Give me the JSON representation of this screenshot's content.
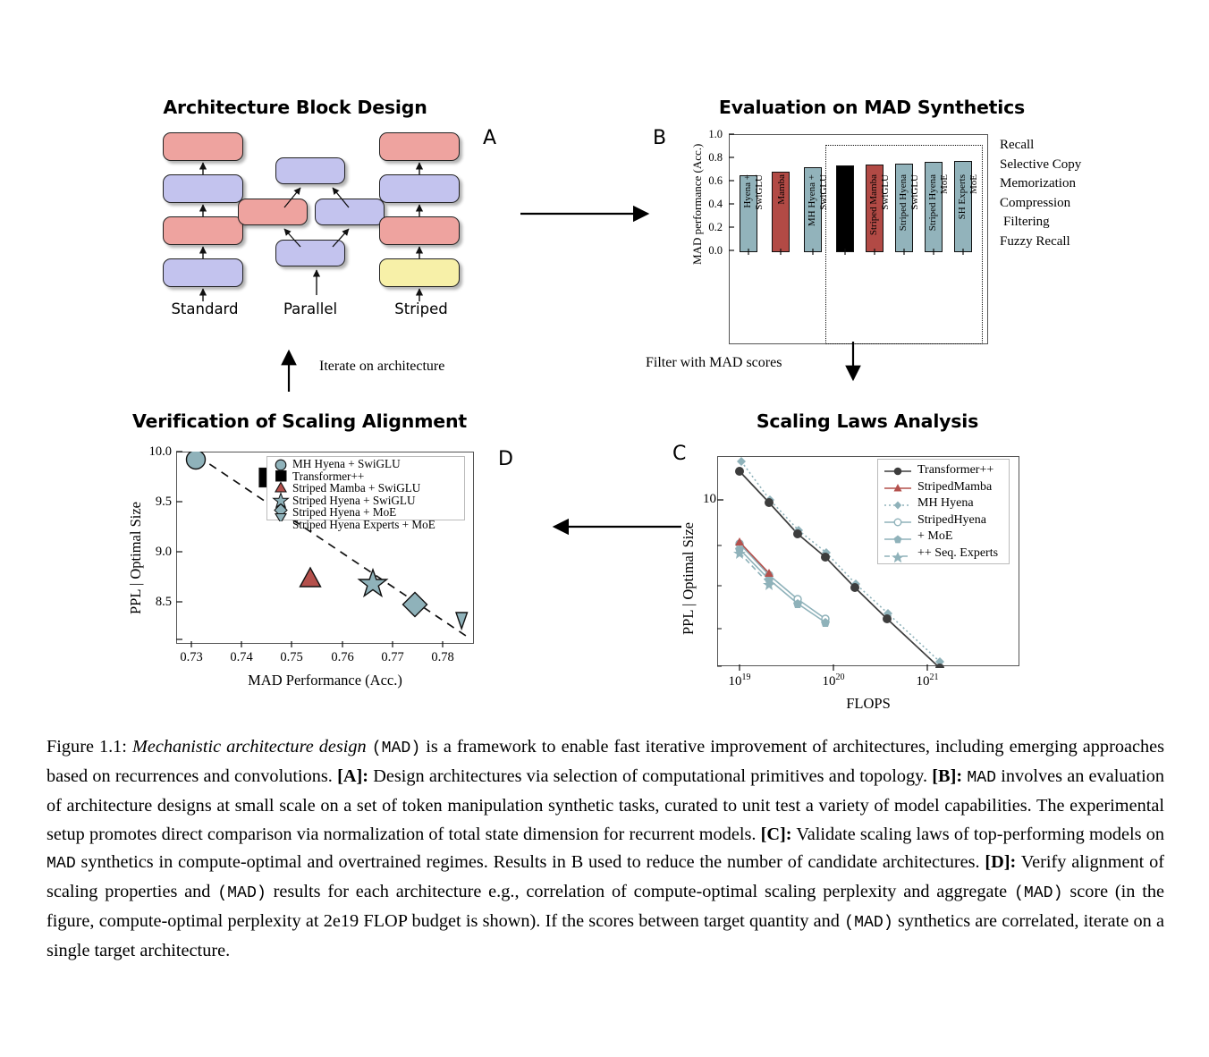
{
  "figure": {
    "label": "Figure 1.1:",
    "caption_segments": [
      {
        "t": "Figure 1.1:",
        "s": "normal"
      },
      {
        "t": "Mechanistic architecture design",
        "s": "italic"
      },
      {
        "t": "(MAD)",
        "s": "mono"
      },
      {
        "t": "is a framework to enable fast iterative improvement of architectures, including emerging approaches based on recurrences and convolutions.",
        "s": "normal"
      },
      {
        "t": "[A]:",
        "s": "bold"
      },
      {
        "t": "Design architectures via selection of computational primitives and topology.",
        "s": "normal"
      },
      {
        "t": "[B]:",
        "s": "bold"
      },
      {
        "t": "MAD",
        "s": "mono"
      },
      {
        "t": "involves an evaluation of architecture designs at small scale on a set of token manipulation synthetic tasks, curated to unit test a variety of model capabilities. The experimental setup promotes direct comparison via normalization of total state dimension for recurrent models.",
        "s": "normal"
      },
      {
        "t": "[C]:",
        "s": "bold"
      },
      {
        "t": "Validate scaling laws of top-performing models on",
        "s": "normal"
      },
      {
        "t": "MAD",
        "s": "mono"
      },
      {
        "t": "synthetics in compute-optimal and overtrained regimes. Results in B used to reduce the number of candidate architectures.",
        "s": "normal"
      },
      {
        "t": "[D]:",
        "s": "bold"
      },
      {
        "t": "Verify alignment of scaling properties and",
        "s": "normal"
      },
      {
        "t": "(MAD)",
        "s": "mono"
      },
      {
        "t": "results for each architecture e.g., correlation of compute-optimal scaling perplexity and aggregate",
        "s": "normal"
      },
      {
        "t": "(MAD)",
        "s": "mono"
      },
      {
        "t": "score (in the figure, compute-optimal perplexity at 2e19 FLOP budget is shown). If the scores between target quantity and",
        "s": "normal"
      },
      {
        "t": "(MAD)",
        "s": "mono"
      },
      {
        "t": "synthetics are correlated, iterate on a single target architecture.",
        "s": "normal"
      }
    ]
  },
  "colors": {
    "block_red": "#eea39f",
    "block_blue": "#c3c3ee",
    "block_yellow": "#f7f0a8",
    "bar_teal": "#92b3bb",
    "bar_red": "#b24a45",
    "bar_black": "#000000",
    "marker_teal": "#8fb2ba",
    "marker_red": "#b4504c",
    "line_dark": "#3d3d3d"
  },
  "panelA": {
    "letter": "A",
    "title": "Architecture Block Design",
    "columns": [
      {
        "name": "Standard",
        "label": "Standard",
        "blocks": [
          {
            "color": "red"
          },
          {
            "color": "blue"
          },
          {
            "color": "red"
          },
          {
            "color": "blue"
          }
        ]
      },
      {
        "name": "Parallel",
        "label": "Parallel",
        "blocks": [
          {
            "color": "blue"
          },
          {
            "color": "red"
          },
          {
            "color": "blue"
          },
          {
            "color": "blue"
          }
        ]
      },
      {
        "name": "Striped",
        "label": "Striped",
        "blocks": [
          {
            "color": "red"
          },
          {
            "color": "blue"
          },
          {
            "color": "red"
          },
          {
            "color": "yellow"
          }
        ]
      }
    ]
  },
  "panelB": {
    "letter": "B",
    "title": "Evaluation on MAD Synthetics",
    "tasks": [
      "Recall",
      "Selective Copy",
      "Memorization",
      "Compression",
      "Filtering",
      "Fuzzy Recall"
    ],
    "chart_data": {
      "type": "bar",
      "title": "Evaluation on MAD Synthetics",
      "xlabel": "",
      "ylabel": "MAD performance (Acc.)",
      "ylim": [
        0.0,
        1.0
      ],
      "yticks": [
        "0.0",
        "0.2",
        "0.4",
        "0.6",
        "0.8",
        "1.0"
      ],
      "grid": false,
      "highlight_group_start": 3,
      "categories": [
        "Hyena +\nSwiGLU",
        "Mamba",
        "MH Hyena +\nSwiGLU",
        "Transformer++",
        "Striped Mamba\nSwiGLU",
        "Striped Hyena\nSwiGLU",
        "Striped Hyena\nMoE",
        "SH Experts\nMoE"
      ],
      "category_lines": [
        [
          "Hyena +",
          "SwiGLU"
        ],
        [
          "Mamba"
        ],
        [
          "MH Hyena +",
          "SwiGLU"
        ],
        [
          "Transformer++"
        ],
        [
          "Striped Mamba",
          "SwiGLU"
        ],
        [
          "Striped Hyena",
          "SwiGLU"
        ],
        [
          "Striped Hyena",
          "MoE"
        ],
        [
          "SH Experts",
          "MoE"
        ]
      ],
      "values": [
        0.661,
        0.693,
        0.732,
        0.747,
        0.752,
        0.765,
        0.774,
        0.783
      ],
      "bar_colors": [
        "teal",
        "red",
        "teal",
        "black",
        "red",
        "teal",
        "teal",
        "teal"
      ]
    }
  },
  "panelC": {
    "letter": "C",
    "title": "Scaling Laws Analysis",
    "chart_data": {
      "type": "line",
      "title": "Scaling Laws Analysis",
      "xlabel": "FLOPS",
      "ylabel": "PPL | Optimal Size",
      "xscale": "log",
      "yscale": "log",
      "xticks": [
        "10^19",
        "10^20",
        "10^21"
      ],
      "yticks": [
        "10^1"
      ],
      "xlim": [
        6e+18,
        3e+21
      ],
      "ylim": [
        1.55,
        22
      ],
      "grid": false,
      "legend_position": "upper right",
      "series": [
        {
          "name": "Transformer++",
          "style": "solid",
          "marker": "circle",
          "color": "line_dark",
          "x": [
            8e+18,
            2e+19,
            4e+19,
            8e+19,
            2e+20,
            5e+20,
            2e+21
          ],
          "y": [
            17.5,
            9.45,
            6.1,
            4.4,
            3.05,
            2.25,
            1.62
          ]
        },
        {
          "name": "StripedMamba",
          "style": "solid",
          "marker": "triangle",
          "color": "marker_red",
          "x": [
            8e+18,
            2e+19
          ],
          "y": [
            10.25,
            5.6
          ]
        },
        {
          "name": "MH Hyena",
          "style": "dotted",
          "marker": "diamond",
          "color": "marker_teal",
          "x": [
            8e+18,
            2e+19,
            4e+19,
            8e+19,
            2e+20,
            5e+20,
            2e+21
          ],
          "y": [
            20.2,
            9.8,
            6.45,
            4.75,
            3.3,
            2.47,
            1.8
          ]
        },
        {
          "name": "StripedHyena",
          "style": "solid",
          "marker": "circle-open",
          "color": "marker_teal",
          "x": [
            8e+18,
            2e+19,
            4e+19,
            8e+19
          ],
          "y": [
            9.95,
            5.48,
            4.1,
            3.2
          ]
        },
        {
          "name": "+ MoE",
          "style": "solid",
          "marker": "pentagon",
          "color": "marker_teal",
          "x": [
            8e+18,
            2e+19,
            4e+19,
            8e+19
          ],
          "y": [
            9.3,
            5.25,
            3.95,
            3.1
          ]
        },
        {
          "name": "++ Seq. Experts",
          "style": "dashed",
          "marker": "star",
          "color": "marker_teal",
          "x": [
            8e+18,
            2e+19
          ],
          "y": [
            8.95,
            5.05
          ]
        }
      ]
    }
  },
  "panelD": {
    "letter": "D",
    "title": "Verification of Scaling Alignment",
    "chart_data": {
      "type": "scatter",
      "title": "Verification of Scaling Alignment",
      "xlabel": "MAD Performance (Acc.)",
      "ylabel": "PPL | Optimal Size",
      "xticks": [
        "0.73",
        "0.74",
        "0.75",
        "0.76",
        "0.77",
        "0.78"
      ],
      "yticks": [
        "8.5",
        "9.0",
        "9.5",
        "10.0"
      ],
      "xlim": [
        0.7265,
        0.7855
      ],
      "ylim": [
        8.12,
        10.02
      ],
      "grid": false,
      "trendline": {
        "style": "dashed",
        "x": [
          0.7305,
          0.7845
        ],
        "y": [
          9.96,
          8.155
        ]
      },
      "legend_position": "upper right",
      "points": [
        {
          "name": "MH Hyena + SwiGLU",
          "marker": "circle",
          "color": "marker_teal",
          "x": 0.7322,
          "y": 9.915
        },
        {
          "name": "Transformer++",
          "marker": "square",
          "color": "bar_black",
          "x": 0.745,
          "y": 9.775
        },
        {
          "name": "Striped Mamba + SwiGLU",
          "marker": "triangle",
          "color": "marker_red",
          "x": 0.7533,
          "y": 8.69
        },
        {
          "name": "Striped Hyena + SwiGLU",
          "marker": "star",
          "color": "marker_teal",
          "x": 0.7658,
          "y": 8.665
        },
        {
          "name": "Striped Hyena + MoE",
          "marker": "diamond",
          "color": "marker_teal",
          "x": 0.7742,
          "y": 8.425
        },
        {
          "name": "Striped Hyena Experts + MoE",
          "marker": "triangle-down",
          "color": "marker_teal",
          "x": 0.7823,
          "y": 8.265
        }
      ]
    }
  },
  "connectors": {
    "a_to_b": "",
    "b_to_c": "Filter with MAD scores",
    "c_to_d": "",
    "d_to_a": "Iterate on architecture"
  }
}
